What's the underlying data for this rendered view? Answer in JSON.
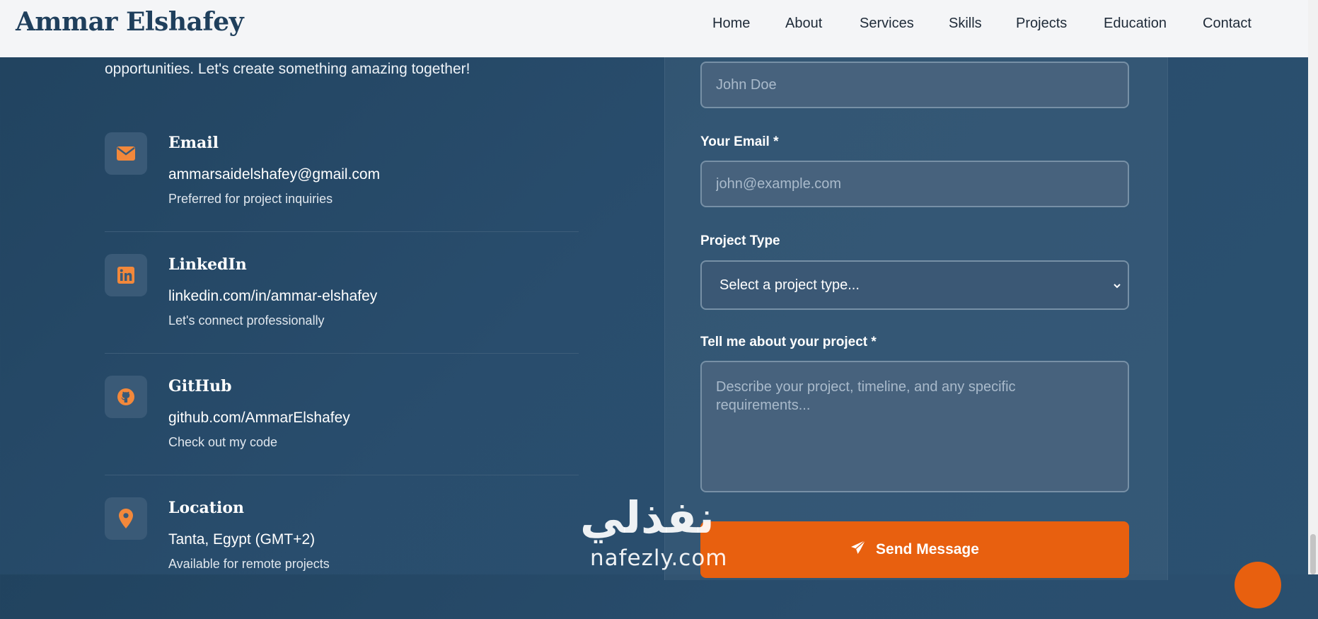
{
  "header": {
    "brand": "Ammar Elshafey",
    "nav": [
      "Home",
      "About",
      "Services",
      "Skills",
      "Projects",
      "Education",
      "Contact"
    ]
  },
  "intro_text": "opportunities. Let's create something amazing together!",
  "contacts": [
    {
      "title": "Email",
      "value": "ammarsaidelshafey@gmail.com",
      "note": "Preferred for project inquiries",
      "icon": "envelope-icon"
    },
    {
      "title": "LinkedIn",
      "value": "linkedin.com/in/ammar-elshafey",
      "note": "Let's connect professionally",
      "icon": "linkedin-icon"
    },
    {
      "title": "GitHub",
      "value": "github.com/AmmarElshafey",
      "note": "Check out my code",
      "icon": "github-icon"
    },
    {
      "title": "Location",
      "value": "Tanta, Egypt (GMT+2)",
      "note": "Available for remote projects",
      "icon": "map-pin-icon"
    }
  ],
  "form": {
    "name_placeholder": "John Doe",
    "email_label": "Your Email *",
    "email_placeholder": "john@example.com",
    "project_type_label": "Project Type",
    "project_type_value": "Select a project type...",
    "message_label": "Tell me about your project *",
    "message_placeholder": "Describe your project, timeline, and any specific requirements...",
    "submit_label": "Send Message"
  },
  "watermark": {
    "arabic": "نفذلي",
    "latin": "nafezly.com"
  },
  "colors": {
    "accent": "#e8600f",
    "background": "#284b6a",
    "navbar": "#f4f5f7"
  }
}
